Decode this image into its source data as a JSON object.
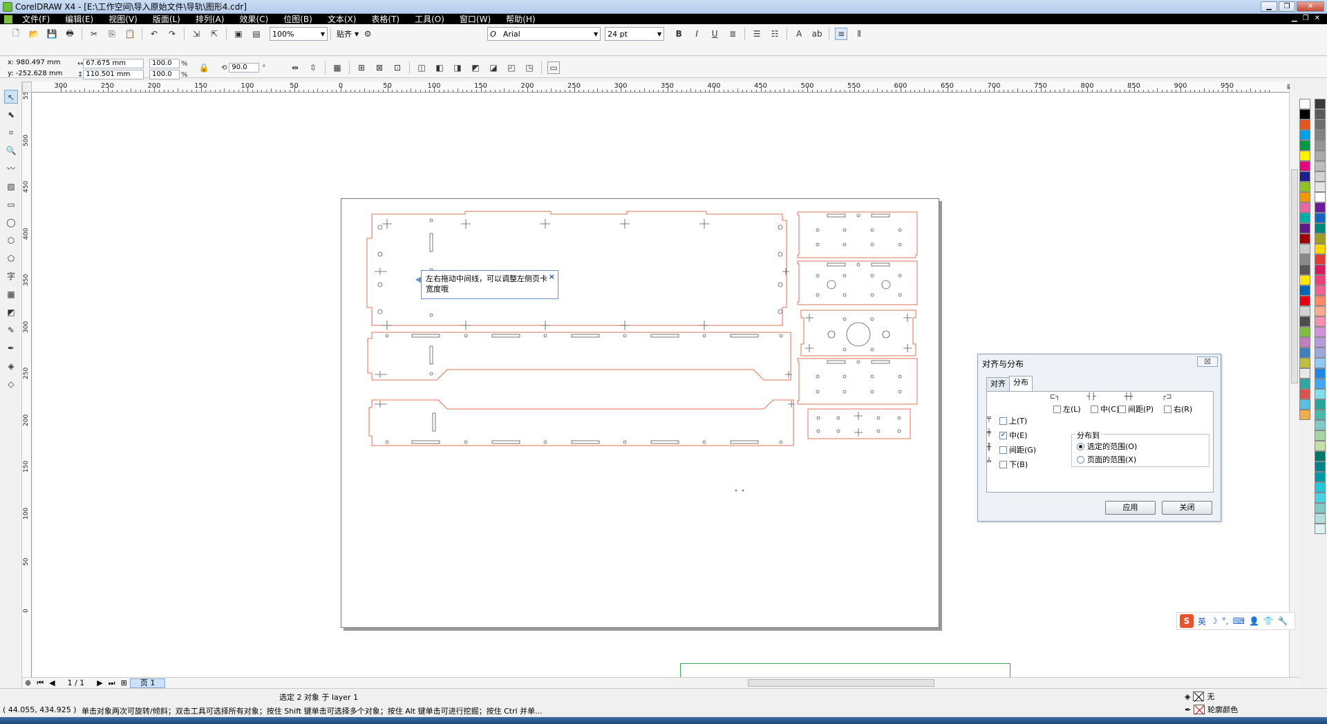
{
  "window": {
    "title": "CorelDRAW X4 - [E:\\工作空间\\导入原始文件\\导轨\\图形4.cdr]"
  },
  "menu": [
    "文件(F)",
    "编辑(E)",
    "视图(V)",
    "版面(L)",
    "排列(A)",
    "效果(C)",
    "位图(B)",
    "文本(X)",
    "表格(T)",
    "工具(O)",
    "窗口(W)",
    "帮助(H)"
  ],
  "toolbar": {
    "zoom": "100%",
    "snap": "贴齐",
    "font": "Arial",
    "font_size": "24 pt"
  },
  "property_bar": {
    "x": "x: 980.497 mm",
    "y": "y: -252.628 mm",
    "width": "67.675 mm",
    "height": "110.501 mm",
    "scale_w": "100.0",
    "scale_h": "100.0",
    "percent": "%",
    "rotation": "90.0",
    "degree": "°"
  },
  "ruler": {
    "h_labels": [
      "300",
      "250",
      "200",
      "150",
      "100",
      "50",
      "0",
      "50",
      "100",
      "150",
      "200",
      "250",
      "300",
      "350",
      "400",
      "450",
      "500",
      "550",
      "600",
      "650",
      "700",
      "750",
      "800",
      "850",
      "900",
      "950"
    ],
    "h_unit": "毫米",
    "v_labels": [
      "550",
      "500",
      "450",
      "400",
      "350",
      "300",
      "250",
      "200",
      "150",
      "100",
      "50",
      "0"
    ]
  },
  "tooltip": {
    "text": "左右拖动中间线，可以调整左侧页卡宽度哦",
    "close": "×"
  },
  "dialog": {
    "title": "对齐与分布",
    "close": "☒",
    "tabs": [
      "对齐",
      "分布"
    ],
    "active_tab": "分布",
    "horizontal_options": [
      {
        "label": "左(L)",
        "checked": false
      },
      {
        "label": "中(C)",
        "checked": false
      },
      {
        "label": "间距(P)",
        "checked": false
      },
      {
        "label": "右(R)",
        "checked": false
      }
    ],
    "vertical_options": [
      {
        "label": "上(T)",
        "checked": false
      },
      {
        "label": "中(E)",
        "checked": true
      },
      {
        "label": "间距(G)",
        "checked": false
      },
      {
        "label": "下(B)",
        "checked": false
      }
    ],
    "distribute_to": {
      "label": "分布到",
      "options": [
        {
          "label": "选定的范围(O)",
          "selected": true
        },
        {
          "label": "页面的范围(X)",
          "selected": false
        }
      ]
    },
    "apply": "应用",
    "close_button": "关闭"
  },
  "page_nav": {
    "count": "1 / 1",
    "tab": "页 1"
  },
  "status": {
    "selection": "选定 2 对象 于 layer 1",
    "coords": "( 44.055, 434.925 )",
    "hint": "单击对象两次可旋转/倾斜；双击工具可选择所有对象；按住 Shift 键单击可选择多个对象；按住 Alt 键单击可进行挖掘；按住 Ctrl 并单...",
    "fill": "无",
    "outline": "轮廓颜色"
  },
  "ime": {
    "logo": "S",
    "mode": "英"
  },
  "palette": [
    "#ffffff",
    "#000000",
    "#e8541e",
    "#00a0e9",
    "#009944",
    "#fff100",
    "#e4007f",
    "#1d2088",
    "#8fc31f",
    "#f39800",
    "#ea68a2",
    "#00ada9",
    "#601986",
    "#a40000",
    "#c9caca",
    "#898989",
    "#595757",
    "#ffe600",
    "#0068b7",
    "#e60012",
    "#d3d3d3",
    "#4d4d4d",
    "#7fbf3f",
    "#bf7fbf",
    "#3f7fbf",
    "#bfbf3f",
    "#e8e8e8",
    "#2fa6a0",
    "#d9534f",
    "#5bc0de",
    "#f0ad4e"
  ],
  "palette2": [
    "#3a3a3a",
    "#5a5a5a",
    "#6e6e6e",
    "#828282",
    "#969696",
    "#aaaaaa",
    "#bebebe",
    "#d2d2d2",
    "#e6e6e6",
    "#ffffff",
    "#6a1b9a",
    "#1565c0",
    "#00897b",
    "#9e9d24",
    "#ffd600",
    "#e53935",
    "#d81b60",
    "#ec407a",
    "#f06292",
    "#ff8a65",
    "#ffab91",
    "#f48fb1",
    "#ce93d8",
    "#b39ddb",
    "#9fa8da",
    "#90caf9",
    "#1e88e5",
    "#42a5f5",
    "#80deea",
    "#26a69a",
    "#4db6ac",
    "#80cbc4",
    "#a5d6a7",
    "#c5e1a5",
    "#00796b",
    "#00838f",
    "#0097a7",
    "#26c6da",
    "#4dd0e1",
    "#80cbc4",
    "#b2dfdb",
    "#e0f2f1"
  ],
  "colors": {
    "outline": "#e07050",
    "accent": "#1e63c6"
  }
}
